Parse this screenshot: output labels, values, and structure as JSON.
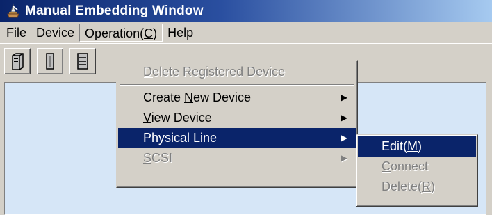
{
  "window": {
    "title": "Manual Embedding Window"
  },
  "menubar": [
    {
      "label": "File",
      "underline": "F",
      "rest": "ile"
    },
    {
      "label": "Device",
      "underline": "D",
      "rest": "evice"
    },
    {
      "label": "Operation(C)",
      "pre": "Operation(",
      "underline": "C",
      "post": ")"
    },
    {
      "label": "Help",
      "underline": "H",
      "rest": "elp"
    }
  ],
  "operation_menu": {
    "delete_registered": {
      "u": "D",
      "rest": "elete Registered Device"
    },
    "create_new": {
      "pre": "Create ",
      "u": "N",
      "rest": "ew Device"
    },
    "view_device": {
      "u": "V",
      "rest": "iew Device"
    },
    "physical_line": {
      "u": "P",
      "rest": "hysical Line"
    },
    "scsi": {
      "u": "S",
      "rest": "CSI"
    }
  },
  "physical_line_submenu": {
    "edit": {
      "pre": "Edit(",
      "u": "M",
      "post": ")"
    },
    "connect": {
      "u": "C",
      "rest": "onnect"
    },
    "delete": {
      "pre": "Delete(",
      "u": "R",
      "post": ")"
    }
  },
  "colors": {
    "titlebar_start": "#0a246a",
    "titlebar_end": "#a6caf0",
    "selection": "#0a246a",
    "panel_bg": "#d6e6f7",
    "face": "#d4d0c8"
  },
  "icons": [
    "app-icon",
    "server-tower-icon",
    "server-slim-icon",
    "server-rack-icon"
  ]
}
